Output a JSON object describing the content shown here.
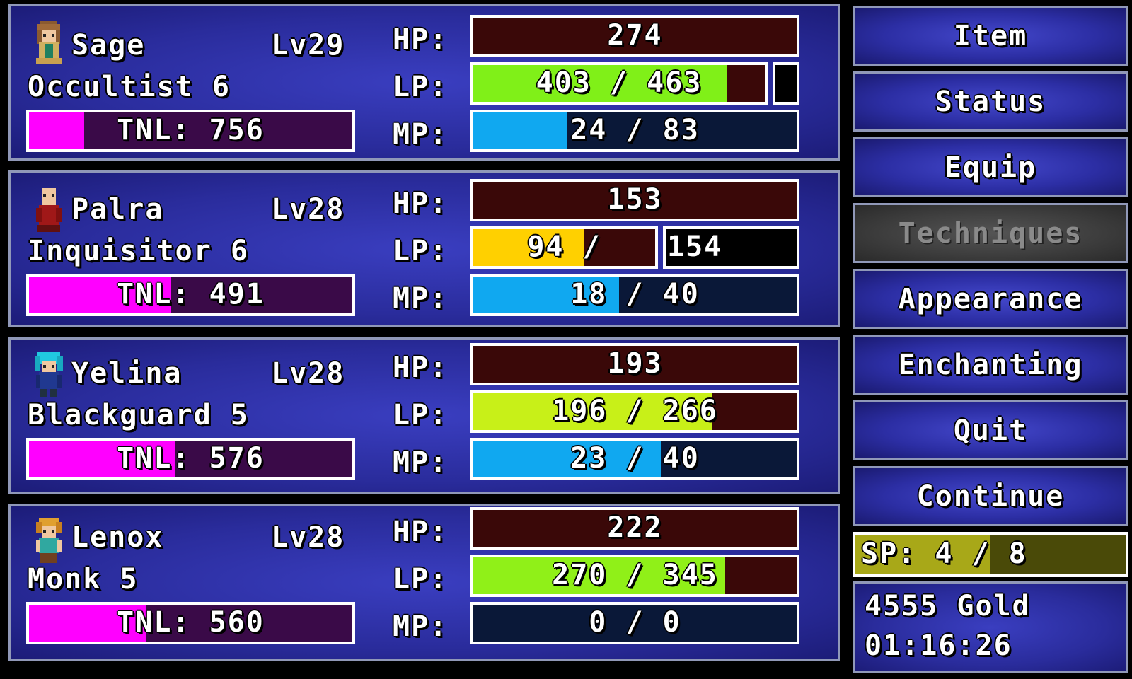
{
  "colors": {
    "hp_bg": "#3a0808",
    "tnl_fill": "#ff00ff",
    "tnl_bg": "#3a0a48",
    "mp_fill": "#10a8f0",
    "mp_bg": "#0a1838",
    "lp_bg": "#3a0808"
  },
  "labels": {
    "hp": "HP:",
    "lp": "LP:",
    "mp": "MP:"
  },
  "party": [
    {
      "name": "Sage",
      "level": "Lv29",
      "class": "Occultist 6",
      "tnl": "TNL: 756",
      "tnl_fill": 0.17,
      "hp": "274",
      "lp": "403 / 463",
      "lp_fill": 0.87,
      "lp_color": "#80f018",
      "mp": "24 / 83",
      "mp_fill": 0.29,
      "portrait": "sage-portrait"
    },
    {
      "name": "Palra",
      "level": "Lv28",
      "class": "Inquisitor 6",
      "tnl": "TNL: 491",
      "tnl_fill": 0.44,
      "hp": "153",
      "lp_current": "94 /",
      "lp_max": "154",
      "lp_fill": 0.61,
      "lp_color": "#ffd000",
      "mp": "18 / 40",
      "mp_fill": 0.45,
      "portrait": "palra-portrait"
    },
    {
      "name": "Yelina",
      "level": "Lv28",
      "class": "Blackguard 5",
      "tnl": "TNL: 576",
      "tnl_fill": 0.45,
      "hp": "193",
      "lp": "196 / 266",
      "lp_fill": 0.74,
      "lp_color": "#c8f018",
      "mp": "23 / 40",
      "mp_fill": 0.58,
      "portrait": "yelina-portrait"
    },
    {
      "name": "Lenox",
      "level": "Lv28",
      "class": "Monk 5",
      "tnl": "TNL: 560",
      "tnl_fill": 0.36,
      "hp": "222",
      "lp": "270 / 345",
      "lp_fill": 0.78,
      "lp_color": "#90f018",
      "mp": "0 / 0",
      "mp_fill": 0,
      "portrait": "lenox-portrait"
    }
  ],
  "menu": [
    {
      "label": "Item",
      "enabled": true
    },
    {
      "label": "Status",
      "enabled": true
    },
    {
      "label": "Equip",
      "enabled": true
    },
    {
      "label": "Techniques",
      "enabled": false
    },
    {
      "label": "Appearance",
      "enabled": true
    },
    {
      "label": "Enchanting",
      "enabled": true
    },
    {
      "label": "Quit",
      "enabled": true
    },
    {
      "label": "Continue",
      "enabled": true
    }
  ],
  "sp": {
    "text": "SP: 4 / 8",
    "fill": 0.5
  },
  "gold": "4555 Gold",
  "playtime": "01:16:26"
}
